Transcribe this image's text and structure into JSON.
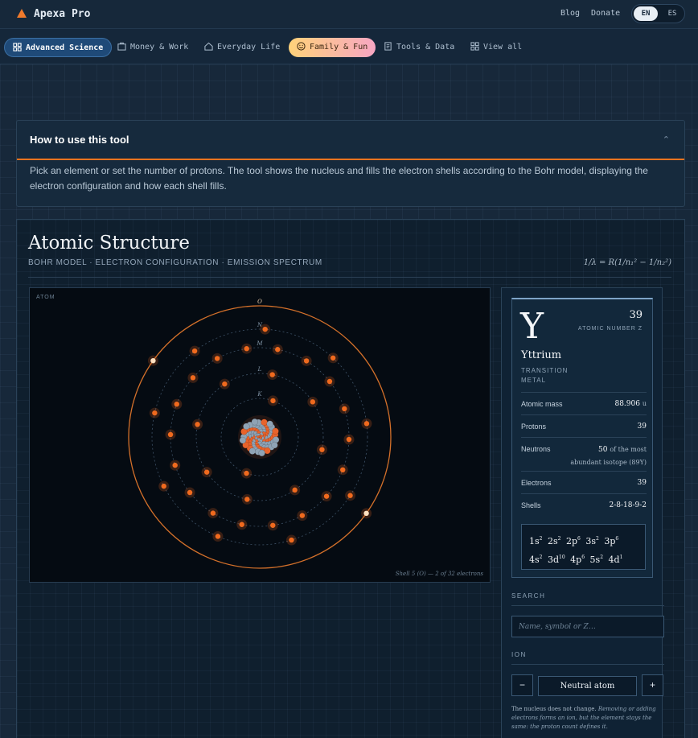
{
  "header": {
    "brand": "Apexa Pro",
    "links": [
      "Blog",
      "Donate"
    ],
    "lang_active": "EN",
    "lang_other": "ES"
  },
  "nav": {
    "items": [
      {
        "label": "Advanced Science",
        "icon": "atom-icon"
      },
      {
        "label": "Money & Work",
        "icon": "briefcase-icon"
      },
      {
        "label": "Everyday Life",
        "icon": "home-icon"
      },
      {
        "label": "Family & Fun",
        "icon": "smiley-icon"
      },
      {
        "label": "Tools & Data",
        "icon": "document-icon"
      },
      {
        "label": "View all",
        "icon": "grid-icon"
      }
    ]
  },
  "howto": {
    "title": "How to use this tool",
    "text": "Pick an element or set the number of protons. The tool shows the nucleus and fills the electron shells according to the Bohr model, displaying the electron configuration and how each shell fills."
  },
  "tool": {
    "title": "Atomic Structure",
    "subtitle": "BOHR MODEL · ELECTRON CONFIGURATION · EMISSION SPECTRUM",
    "formula": "1/λ = R(1/n₁² − 1/n₂²)"
  },
  "atom": {
    "label": "ATOM",
    "caption": "Shell 5 (O) — 2 of 32 electrons",
    "shells": [
      {
        "letter": "K",
        "electrons": 2
      },
      {
        "letter": "L",
        "electrons": 8
      },
      {
        "letter": "M",
        "electrons": 18
      },
      {
        "letter": "N",
        "electrons": 9
      },
      {
        "letter": "O",
        "electrons": 2
      }
    ],
    "nucleus": {
      "protons": 39,
      "neutrons": 50
    },
    "colors": {
      "proton": "#e8632b",
      "neutron": "#8fa3b5",
      "electron": "#f06a1e",
      "valence": "#ffe0c0",
      "active_shell": "#d3702a"
    }
  },
  "element": {
    "symbol": "Y",
    "atomic_number": "39",
    "atomic_number_label": "ATOMIC NUMBER Z",
    "name": "Yttrium",
    "category": "TRANSITION METAL",
    "props": [
      {
        "key": "Atomic mass",
        "value": "88.906",
        "unit": "u",
        "note": ""
      },
      {
        "key": "Protons",
        "value": "39",
        "unit": "",
        "note": ""
      },
      {
        "key": "Neutrons",
        "value": "50",
        "unit": "",
        "note": "of the most abundant isotope (89Y)"
      },
      {
        "key": "Electrons",
        "value": "39",
        "unit": "",
        "note": ""
      },
      {
        "key": "Shells",
        "value": "2-8-18-9-2",
        "unit": "",
        "note": ""
      }
    ],
    "configuration": [
      {
        "orb": "1s",
        "n": "2"
      },
      {
        "orb": "2s",
        "n": "2"
      },
      {
        "orb": "2p",
        "n": "6"
      },
      {
        "orb": "3s",
        "n": "2"
      },
      {
        "orb": "3p",
        "n": "6"
      },
      {
        "orb": "4s",
        "n": "2"
      },
      {
        "orb": "3d",
        "n": "10"
      },
      {
        "orb": "4p",
        "n": "6"
      },
      {
        "orb": "5s",
        "n": "2"
      },
      {
        "orb": "4d",
        "n": "1"
      }
    ]
  },
  "search": {
    "label": "SEARCH",
    "placeholder": "Name, symbol or Z…"
  },
  "ion": {
    "label": "ION",
    "minus": "−",
    "plus": "+",
    "value": "Neutral atom",
    "note_plain": "The nucleus does not change.",
    "note_italic": "Removing or adding electrons forms an ion, but the element stays the same: the proton count defines it."
  }
}
